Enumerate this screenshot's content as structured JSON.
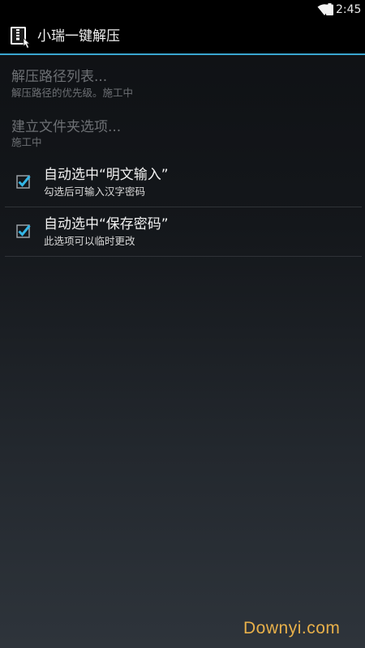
{
  "status_bar": {
    "time": "2:45",
    "icons": [
      "wifi-icon",
      "battery-icon"
    ]
  },
  "action_bar": {
    "app_icon": "zip-archive-icon",
    "title": "小瑞一键解压",
    "accent_color": "#3aa6d0"
  },
  "preferences": [
    {
      "title": "解压路径列表...",
      "summary": "解压路径的优先级。施工中",
      "enabled": false
    },
    {
      "title": "建立文件夹选项...",
      "summary": "施工中",
      "enabled": false
    },
    {
      "title": "自动选中“明文输入”",
      "summary": "勾选后可输入汉字密码",
      "checked": true
    },
    {
      "title": "自动选中“保存密码”",
      "summary": "此选项可以临时更改",
      "checked": true
    }
  ],
  "watermark": "Downyi.com"
}
